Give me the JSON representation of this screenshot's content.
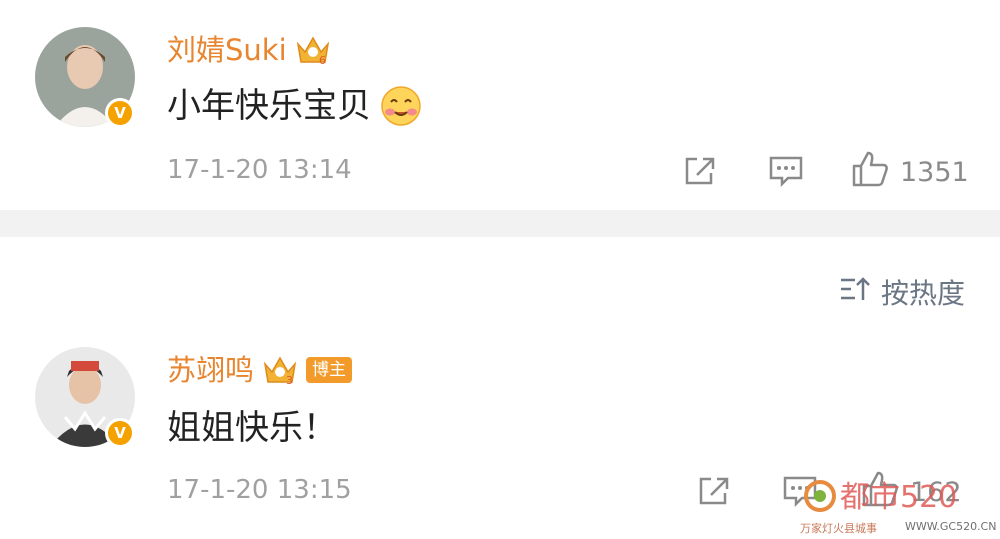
{
  "colors": {
    "username": "#e8852f",
    "badge": "#f5a100",
    "meta": "#a0a0a0",
    "divider": "#f2f2f2"
  },
  "posts": [
    {
      "username": "刘婧Suki",
      "level": "6",
      "text": "小年快乐宝贝",
      "emoji": "blushing-face-emoji",
      "timestamp": "17-1-20 13:14",
      "likes": "1351",
      "verified_badge": "V"
    },
    {
      "username": "苏翊鸣",
      "level": "3",
      "badge": "博主",
      "text": "姐姐快乐！",
      "timestamp": "17-1-20 13:15",
      "likes": "162",
      "verified_badge": "V"
    }
  ],
  "sort": {
    "label": "按热度",
    "icon": "sort-icon"
  },
  "watermark": {
    "main": "都市520",
    "sub": "万家灯火县城事",
    "url": "WWW.GC520.CN"
  }
}
